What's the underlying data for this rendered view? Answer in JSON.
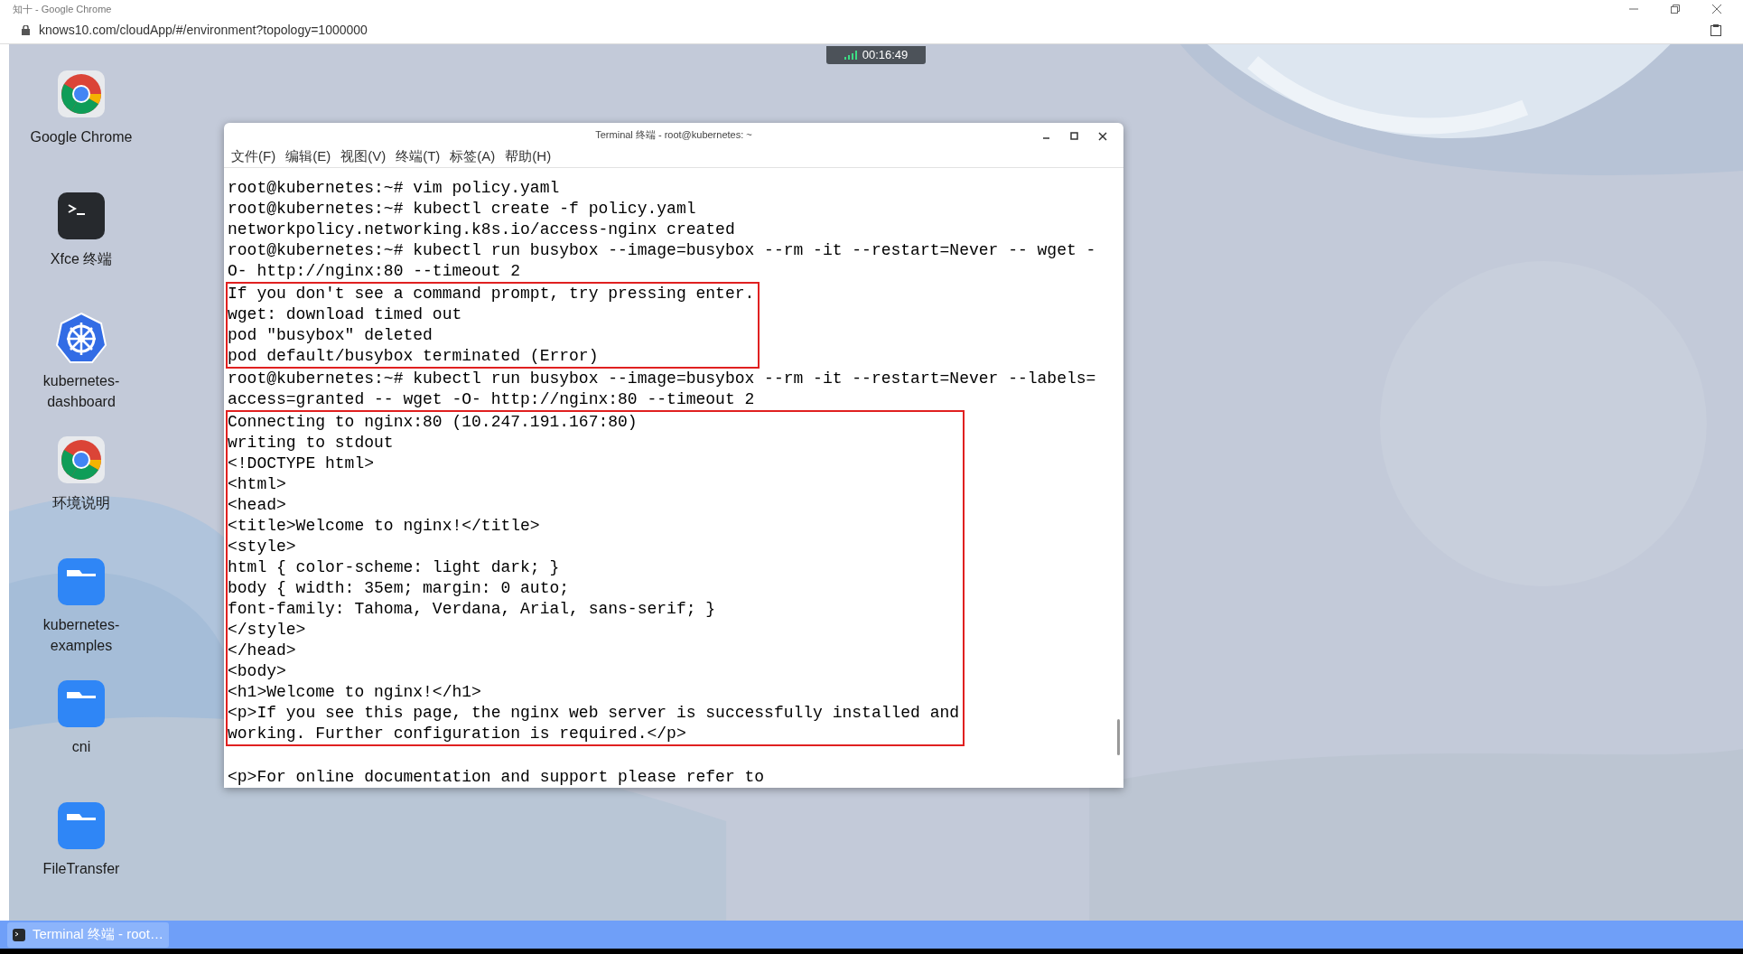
{
  "browser": {
    "title": "知十 - Google Chrome",
    "url": "knows10.com/cloudApp/#/environment?topology=1000000"
  },
  "session_timer": "00:16:49",
  "desktop_icons": [
    {
      "kind": "chrome",
      "label": "Google Chrome"
    },
    {
      "kind": "terminal",
      "label": "Xfce 终端"
    },
    {
      "kind": "kubernetes",
      "label": "kubernetes-dashboard"
    },
    {
      "kind": "chrome",
      "label": "环境说明"
    },
    {
      "kind": "folder",
      "label": "kubernetes-examples"
    },
    {
      "kind": "folder",
      "label": "cni"
    },
    {
      "kind": "folder",
      "label": "FileTransfer"
    }
  ],
  "terminal": {
    "title": "Terminal 终端 - root@kubernetes: ~",
    "menu": [
      "文件(F)",
      "编辑(E)",
      "视图(V)",
      "终端(T)",
      "标签(A)",
      "帮助(H)"
    ],
    "blocks": [
      {
        "boxed": false,
        "blank_line_before": false,
        "lines": [
          "root@kubernetes:~# vim policy.yaml",
          "root@kubernetes:~# kubectl create -f policy.yaml",
          "networkpolicy.networking.k8s.io/access-nginx created",
          "root@kubernetes:~# kubectl run busybox --image=busybox --rm -it --restart=Never -- wget -",
          "O- http://nginx:80 --timeout 2"
        ]
      },
      {
        "boxed": true,
        "lines": [
          "If you don't see a command prompt, try pressing enter.",
          "wget: download timed out",
          "pod \"busybox\" deleted",
          "pod default/busybox terminated (Error)"
        ]
      },
      {
        "boxed": false,
        "blank_line_before": false,
        "lines": [
          "root@kubernetes:~# kubectl run busybox --image=busybox --rm -it --restart=Never --labels=",
          "access=granted -- wget -O- http://nginx:80 --timeout 2"
        ]
      },
      {
        "boxed": true,
        "lines": [
          "Connecting to nginx:80 (10.247.191.167:80)",
          "writing to stdout",
          "<!DOCTYPE html>",
          "<html>",
          "<head>",
          "<title>Welcome to nginx!</title>",
          "<style>",
          "html { color-scheme: light dark; }",
          "body { width: 35em; margin: 0 auto;",
          "font-family: Tahoma, Verdana, Arial, sans-serif; }",
          "</style>",
          "</head>",
          "<body>",
          "<h1>Welcome to nginx!</h1>",
          "<p>If you see this page, the nginx web server is successfully installed and",
          "working. Further configuration is required.</p>"
        ]
      },
      {
        "boxed": false,
        "blank_line_before": true,
        "lines": [
          "<p>For online documentation and support please refer to"
        ]
      }
    ]
  },
  "taskbar": {
    "items": [
      {
        "label": "Terminal 终端 - root…",
        "selected": true
      }
    ]
  }
}
